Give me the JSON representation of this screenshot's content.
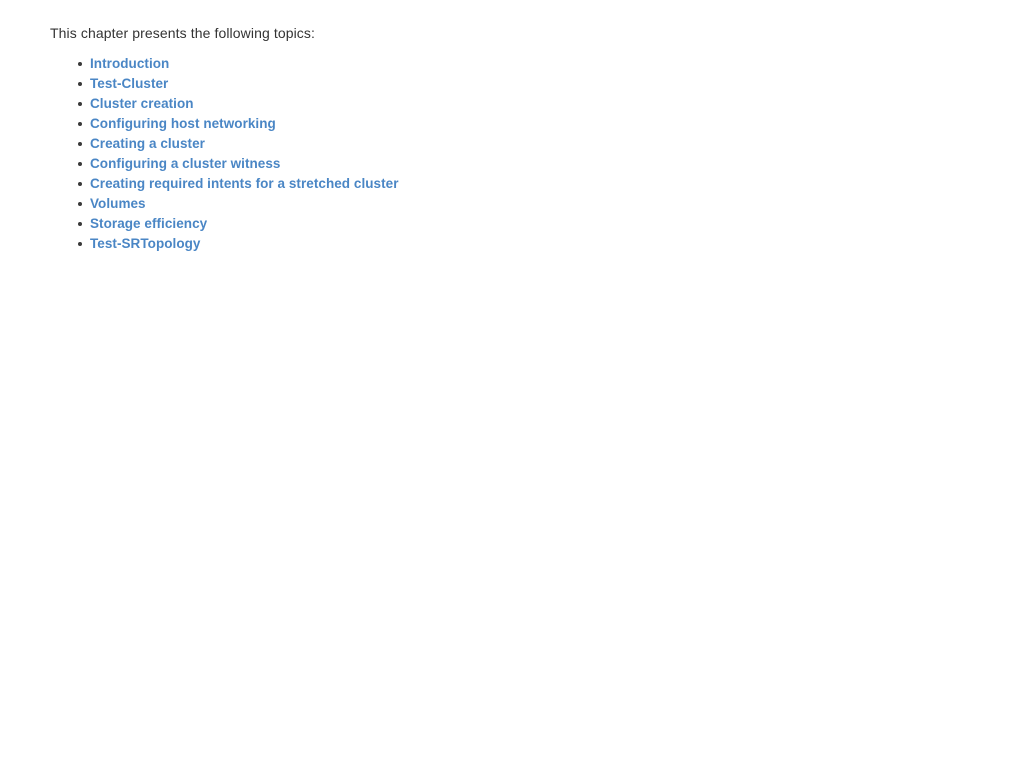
{
  "page": {
    "background_color": "#ffffff",
    "text_color": "#333333",
    "link_color": "#4a86c5",
    "bullet_color": "#3a3a3a"
  },
  "intro": {
    "text": "This chapter presents the following topics:"
  },
  "topics": [
    {
      "label": "Introduction"
    },
    {
      "label": "Test-Cluster"
    },
    {
      "label": "Cluster creation"
    },
    {
      "label": "Configuring host networking"
    },
    {
      "label": "Creating a cluster"
    },
    {
      "label": "Configuring a cluster witness"
    },
    {
      "label": "Creating required intents for a stretched cluster"
    },
    {
      "label": "Volumes"
    },
    {
      "label": "Storage efficiency"
    },
    {
      "label": "Test-SRTopology"
    }
  ]
}
